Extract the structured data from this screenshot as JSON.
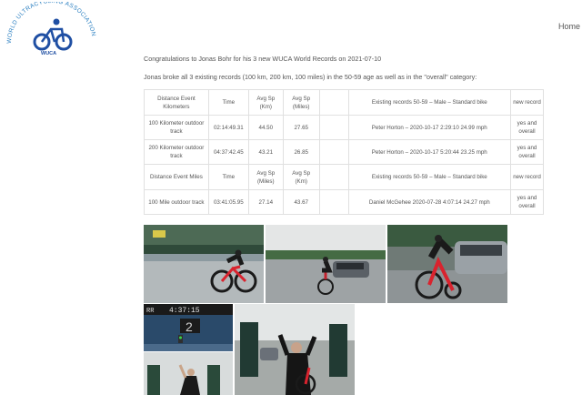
{
  "site": {
    "logo_text": "WORLD ULTRACYCLING ASSOCIATION",
    "logo_abbrev": "WUCA",
    "nav_home": "Home"
  },
  "article": {
    "intro1": "Congratulations to Jonas Bohr for his 3 new WUCA World Records on 2021-07-10",
    "intro2": "Jonas broke all 3 existing records (100 km, 200 km, 100 miles) in the 50-59 age as well as in the \"overall\" category:"
  },
  "table": {
    "km_header": {
      "event": "Distance Event Kilometers",
      "time": "Time",
      "avg1": "Avg Sp (Km)",
      "avg2": "Avg Sp (Miles)",
      "existing": "Existing records 50-59 – Male – Standard bike",
      "new": "new record"
    },
    "km_rows": [
      {
        "event": "100 Kilometer outdoor track",
        "time": "02:14:49.31",
        "avg1": "44.50",
        "avg2": "27.65",
        "existing": "Peter Horton – 2020-10-17 2:29:10 24.99 mph",
        "new": "yes and overall"
      },
      {
        "event": "200 Kilometer outdoor track",
        "time": "04:37:42.45",
        "avg1": "43.21",
        "avg2": "26.85",
        "existing": "Peter Horton – 2020-10-17 5:20:44 23.25 mph",
        "new": "yes and overall"
      }
    ],
    "mi_header": {
      "event": "Distance Event Miles",
      "time": "Time",
      "avg1": "Avg Sp (Miles)",
      "avg2": "Avg Sp (Km)",
      "existing": "Existing records 50-59 – Male – Standard bike",
      "new": "new record"
    },
    "mi_rows": [
      {
        "event": "100 Mile outdoor track",
        "time": "03:41:05.95",
        "avg1": "27.14",
        "avg2": "43.67",
        "existing": "Daniel McGehee 2020-07-28 4:07:14 24.27 mph",
        "new": "yes and overall"
      }
    ]
  },
  "photos": {
    "scoreboard_time": "4:37:15",
    "scoreboard_lap": "2",
    "scoreboard_label": "RR"
  }
}
